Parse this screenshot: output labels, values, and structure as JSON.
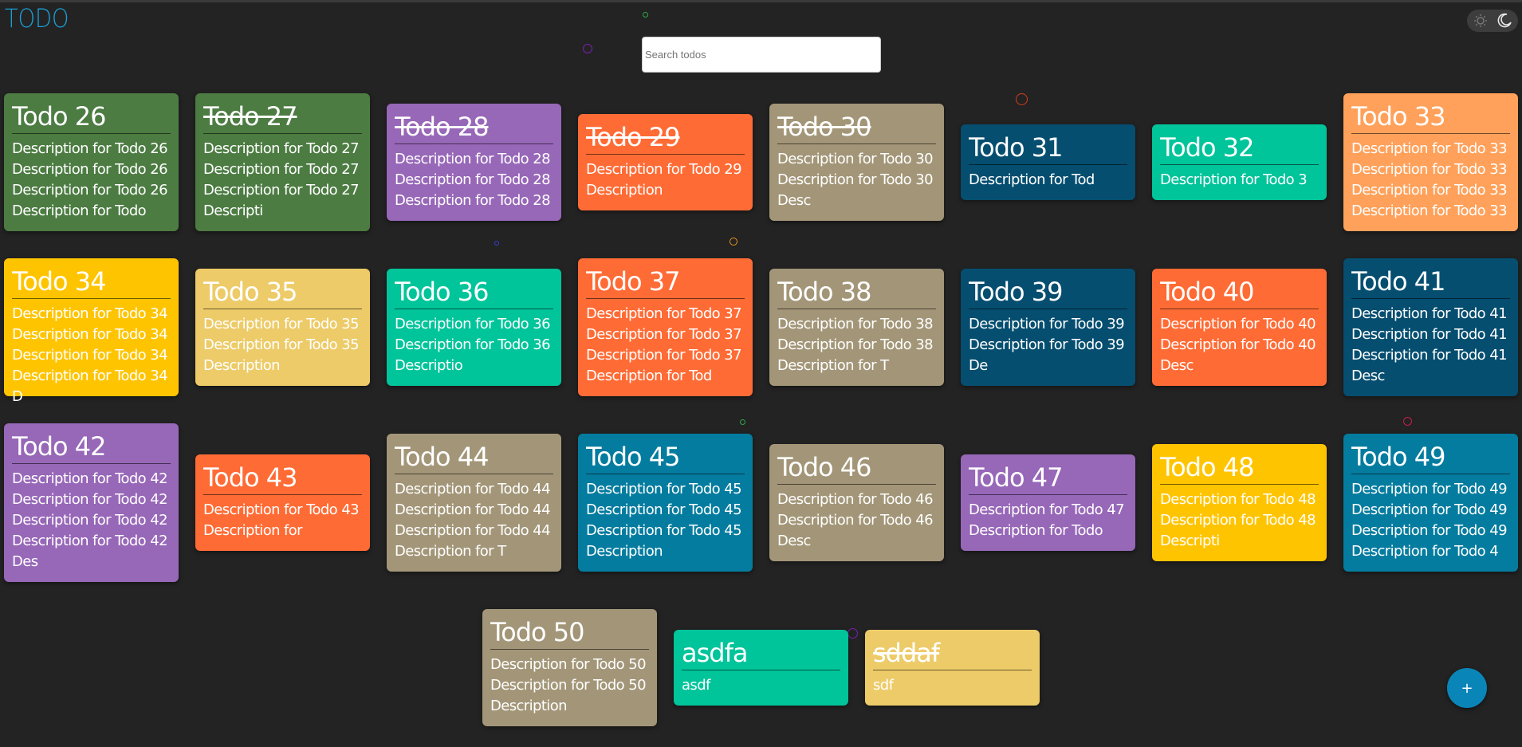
{
  "app": {
    "logo": "TODO"
  },
  "search": {
    "placeholder": "Search todos",
    "value": ""
  },
  "theme_toggle": {
    "light_icon": "sun-icon",
    "dark_icon": "moon-icon"
  },
  "fab": {
    "label": "+",
    "icon": "plus-icon"
  },
  "colors": {
    "green": "#4c7c42",
    "purple": "#9767b8",
    "orange": "#ff6b35",
    "taupe": "#a39678",
    "navy": "#054e70",
    "teal": "#00c49a",
    "peach": "#ffa15a",
    "yellow": "#ffc400",
    "sand": "#edcb68",
    "blue": "#047c9f"
  },
  "todos": [
    {
      "title": "Todo 26",
      "lines": [
        "Description for Todo 26",
        "Description for Todo 26",
        "Description for Todo 26",
        "Description for Todo"
      ],
      "color": "#4c7c42",
      "done": false
    },
    {
      "title": "Todo 27",
      "lines": [
        "Description for Todo 27",
        "Description for Todo 27",
        "Description for Todo 27",
        "Descripti"
      ],
      "color": "#4c7c42",
      "done": true
    },
    {
      "title": "Todo 28",
      "lines": [
        "Description for Todo 28",
        "Description for Todo 28",
        "Description for Todo 28"
      ],
      "color": "#9767b8",
      "done": true
    },
    {
      "title": "Todo 29",
      "lines": [
        "Description for Todo 29",
        "Description"
      ],
      "color": "#ff6b35",
      "done": true
    },
    {
      "title": "Todo 30",
      "lines": [
        "Description for Todo 30",
        "Description for Todo 30",
        "Desc"
      ],
      "color": "#a39678",
      "done": true
    },
    {
      "title": "Todo 31",
      "lines": [
        "Description for Tod"
      ],
      "color": "#054e70",
      "done": false
    },
    {
      "title": "Todo 32",
      "lines": [
        "Description for Todo 3"
      ],
      "color": "#00c49a",
      "done": false
    },
    {
      "title": "Todo 33",
      "lines": [
        "Description for Todo 33",
        "Description for Todo 33",
        "Description for Todo 33",
        "Description for Todo 33"
      ],
      "color": "#ffa15a",
      "done": false
    },
    {
      "title": "Todo 34",
      "lines": [
        "Description for Todo 34",
        "Description for Todo 34",
        "Description for Todo 34",
        "Description for Todo 34 D"
      ],
      "color": "#ffc400",
      "done": false
    },
    {
      "title": "Todo 35",
      "lines": [
        "Description for Todo 35",
        "Description for Todo 35",
        "Description"
      ],
      "color": "#edcb68",
      "done": false
    },
    {
      "title": "Todo 36",
      "lines": [
        "Description for Todo 36",
        "Description for Todo 36",
        "Descriptio"
      ],
      "color": "#00c49a",
      "done": false
    },
    {
      "title": "Todo 37",
      "lines": [
        "Description for Todo 37",
        "Description for Todo 37",
        "Description for Todo 37",
        "Description for Tod"
      ],
      "color": "#ff6b35",
      "done": false
    },
    {
      "title": "Todo 38",
      "lines": [
        "Description for Todo 38",
        "Description for Todo 38",
        "Description for T"
      ],
      "color": "#a39678",
      "done": false
    },
    {
      "title": "Todo 39",
      "lines": [
        "Description for Todo 39",
        "Description for Todo 39",
        "De"
      ],
      "color": "#054e70",
      "done": false
    },
    {
      "title": "Todo 40",
      "lines": [
        "Description for Todo 40",
        "Description for Todo 40",
        "Desc"
      ],
      "color": "#ff6b35",
      "done": false
    },
    {
      "title": "Todo 41",
      "lines": [
        "Description for Todo 41",
        "Description for Todo 41",
        "Description for Todo 41",
        "Desc"
      ],
      "color": "#054e70",
      "done": false
    },
    {
      "title": "Todo 42",
      "lines": [
        "Description for Todo 42",
        "Description for Todo 42",
        "Description for Todo 42",
        "Description for Todo 42",
        "Des"
      ],
      "color": "#9767b8",
      "done": false
    },
    {
      "title": "Todo 43",
      "lines": [
        "Description for Todo 43",
        "Description for"
      ],
      "color": "#ff6b35",
      "done": false
    },
    {
      "title": "Todo 44",
      "lines": [
        "Description for Todo 44",
        "Description for Todo 44",
        "Description for Todo 44",
        "Description for T"
      ],
      "color": "#a39678",
      "done": false
    },
    {
      "title": "Todo 45",
      "lines": [
        "Description for Todo 45",
        "Description for Todo 45",
        "Description for Todo 45",
        "Description"
      ],
      "color": "#047c9f",
      "done": false
    },
    {
      "title": "Todo 46",
      "lines": [
        "Description for Todo 46",
        "Description for Todo 46",
        "Desc"
      ],
      "color": "#a39678",
      "done": false
    },
    {
      "title": "Todo 47",
      "lines": [
        "Description for Todo 47",
        "Description for Todo"
      ],
      "color": "#9767b8",
      "done": false
    },
    {
      "title": "Todo 48",
      "lines": [
        "Description for Todo 48",
        "Description for Todo 48",
        "Descripti"
      ],
      "color": "#ffc400",
      "done": false
    },
    {
      "title": "Todo 49",
      "lines": [
        "Description for Todo 49",
        "Description for Todo 49",
        "Description for Todo 49",
        "Description for Todo 4"
      ],
      "color": "#047c9f",
      "done": false
    },
    {
      "title": "Todo 50",
      "lines": [
        "Description for Todo 50",
        "Description for Todo 50",
        "Description"
      ],
      "color": "#a39678",
      "done": false
    },
    {
      "title": "asdfa",
      "lines": [
        "asdf"
      ],
      "color": "#00c49a",
      "done": false
    },
    {
      "title": "sddaf",
      "lines": [
        "sdf"
      ],
      "color": "#edcb68",
      "done": true
    }
  ]
}
